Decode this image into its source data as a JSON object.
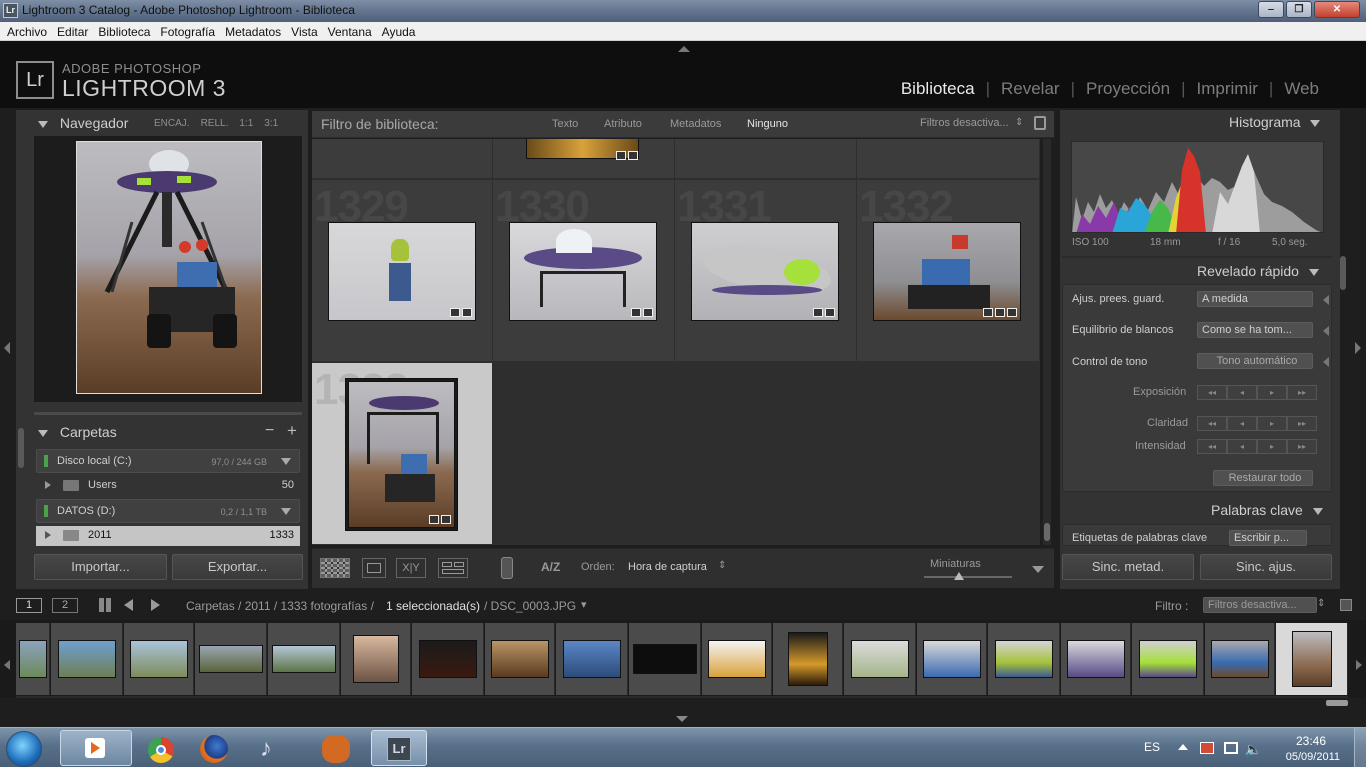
{
  "window": {
    "title": "Lightroom 3 Catalog - Adobe Photoshop Lightroom - Biblioteca",
    "icon": "Lr",
    "minimize": "‒",
    "maximize": "❐",
    "close": "✕"
  },
  "menubar": [
    "Archivo",
    "Editar",
    "Biblioteca",
    "Fotografía",
    "Metadatos",
    "Vista",
    "Ventana",
    "Ayuda"
  ],
  "brand": {
    "logo": "Lr",
    "top": "ADOBE PHOTOSHOP",
    "main": "LIGHTROOM 3"
  },
  "modules": [
    "Biblioteca",
    "Revelar",
    "Proyección",
    "Imprimir",
    "Web"
  ],
  "navigator": {
    "title": "Navegador",
    "zoom_options": [
      "ENCAJ.",
      "RELL.",
      "1:1",
      "3:1"
    ]
  },
  "folders": {
    "title": "Carpetas",
    "minus": "−",
    "plus": "+",
    "volumes": [
      {
        "name": "Disco local (C:)",
        "size": "97,0 / 244 GB",
        "children": [
          {
            "name": "Users",
            "count": "50"
          }
        ]
      },
      {
        "name": "DATOS (D:)",
        "size": "0,2 / 1,1 TB",
        "children": [
          {
            "name": "2011",
            "count": "1333"
          }
        ]
      }
    ]
  },
  "left_buttons": {
    "import": "Importar...",
    "export": "Exportar..."
  },
  "filterbar": {
    "label": "Filtro de biblioteca:",
    "options": [
      "Texto",
      "Atributo",
      "Metadatos",
      "Ninguno"
    ],
    "active": "Ninguno",
    "preset": "Filtros desactiva...",
    "preset_arrows": "⇕",
    "lock_icon": "lock-icon"
  },
  "grid": {
    "cells": [
      {
        "num": "1329"
      },
      {
        "num": "1330"
      },
      {
        "num": "1331"
      },
      {
        "num": "1332"
      },
      {
        "num": "1333",
        "selected": true
      }
    ]
  },
  "toolbar": {
    "sort_label": "Orden:",
    "sort_value": "Hora de captura",
    "sort_arrows": "⇕",
    "az_icon": "A/Z",
    "xy_icon": "X|Y",
    "thumbs_label": "Miniaturas"
  },
  "histogram": {
    "title": "Histograma",
    "iso": "ISO 100",
    "focal": "18 mm",
    "aperture": "f / 16",
    "shutter": "5,0 seg."
  },
  "quick_develop": {
    "title": "Revelado rápido",
    "preset_label": "Ajus. prees. guard.",
    "preset_value": "A medida",
    "wb_label": "Equilibrio de blancos",
    "wb_value": "Como se ha tom...",
    "tone_label": "Control de tono",
    "tone_button": "Tono automático",
    "exposure": "Exposición",
    "clarity": "Claridad",
    "vibrance": "Intensidad",
    "step_buttons": [
      "◂◂",
      "◂",
      "▸",
      "▸▸"
    ],
    "reset": "Restaurar todo"
  },
  "keywords": {
    "title": "Palabras clave",
    "tag_label": "Etiquetas de palabras clave",
    "tag_value": "Escribir p..."
  },
  "right_buttons": {
    "sync_meta": "Sinc. metad.",
    "sync_settings": "Sinc. ajus."
  },
  "pathbar": {
    "view1": "1",
    "view2": "2",
    "path": "Carpetas / 2011 / 1333 fotografías /",
    "selection": "1 seleccionada(s)",
    "file": "/ DSC_0003.JPG",
    "file_arrow": "▾",
    "filter_label": "Filtro :",
    "filter_value": "Filtros desactiva...",
    "filter_arrows": "⇕"
  },
  "taskbar": {
    "lang": "ES",
    "time": "23:46",
    "date": "05/09/2011",
    "lr_label": "Lr"
  },
  "colors": {
    "accent": "#eaeaea",
    "panel": "#333333",
    "background": "#1e1e1e",
    "selected_cell": "#c9c9c9"
  }
}
